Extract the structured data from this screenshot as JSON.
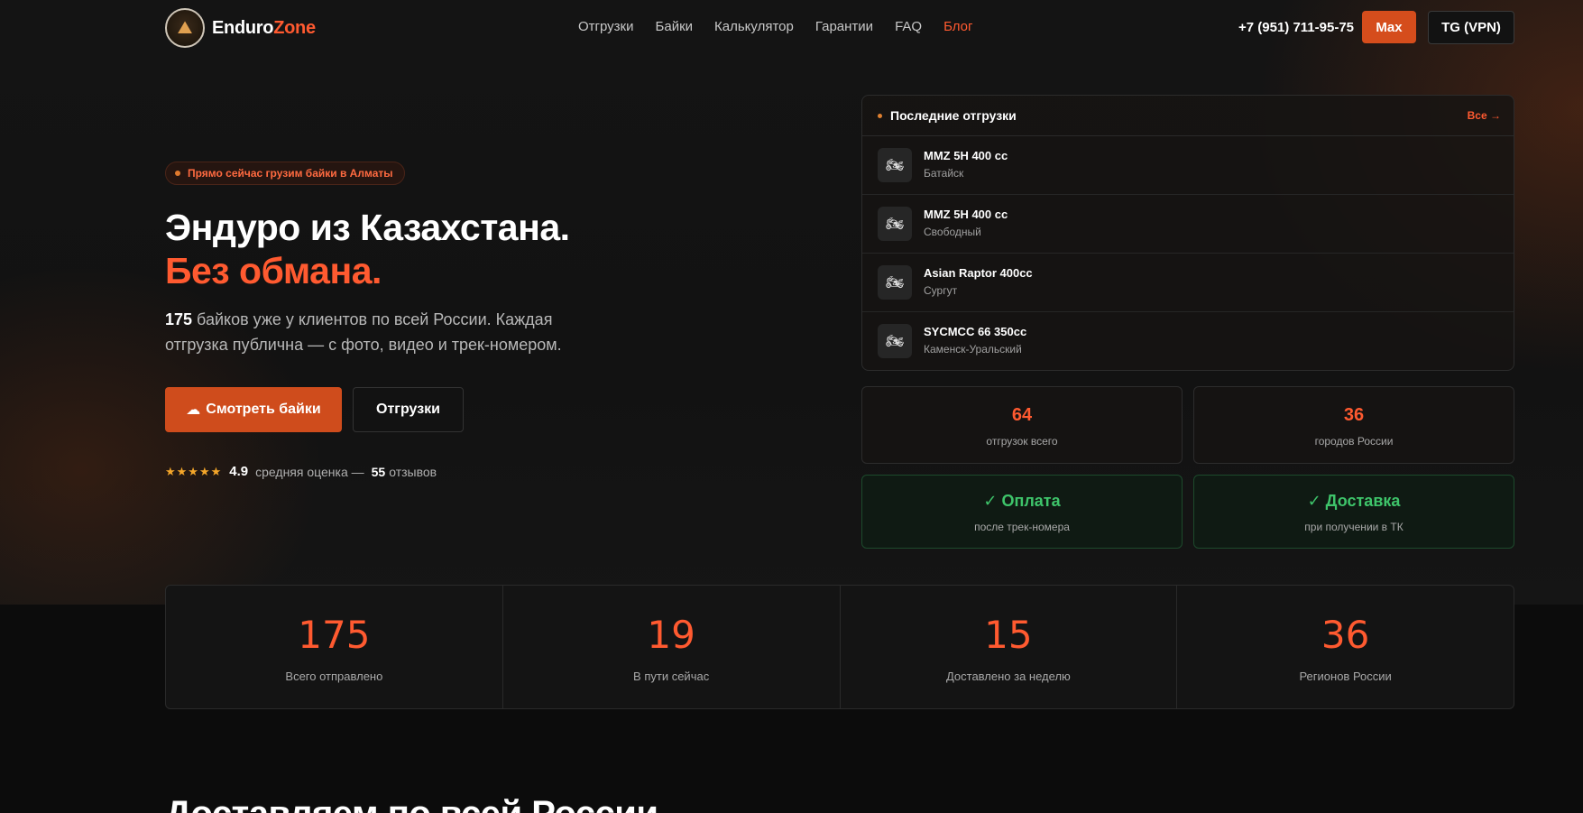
{
  "header": {
    "logo_a": "Enduro",
    "logo_b": "Zone",
    "nav": [
      {
        "label": "Отгрузки"
      },
      {
        "label": "Байки"
      },
      {
        "label": "Калькулятор"
      },
      {
        "label": "Гарантии"
      },
      {
        "label": "FAQ"
      },
      {
        "label": "Блог"
      }
    ],
    "active_nav": "Блог",
    "phone": "+7 (951) 711-95-75",
    "max_label": "Max",
    "tg_label": "TG (VPN)"
  },
  "hero": {
    "badge": "Прямо сейчас грузим байки в Алматы",
    "title_line1": "Эндуро из Казахстана.",
    "title_line2": "Без обмана.",
    "desc_count": "175",
    "desc_rest_line1": " байков уже у клиентов по всей России. Каждая",
    "desc_line2": "отгрузка публична — с фото, видео и трек-номером.",
    "primary_button": "Смотреть байки",
    "secondary_button": "Отгрузки",
    "stars": "★★★★★",
    "score": "4.9",
    "rating_mid": "средняя оценка —",
    "reviews_count": "55",
    "reviews_word": "отзывов"
  },
  "shipments": {
    "title": "Последние отгрузки",
    "all_link": "Все →",
    "items": [
      {
        "name": "MMZ 5H 400 cc",
        "city": "Батайск"
      },
      {
        "name": "MMZ 5H 400 cc",
        "city": "Свободный"
      },
      {
        "name": "Asian Raptor 400cc",
        "city": "Сургут"
      },
      {
        "name": "SYCMCC 66 350cc",
        "city": "Каменск-Уральский"
      }
    ]
  },
  "cards": {
    "shipments_total": {
      "value": "64",
      "label": "отгрузок всего"
    },
    "cities": {
      "value": "36",
      "label": "городов России"
    },
    "payment": {
      "value": "✓ Оплата",
      "label": "после трек-номера"
    },
    "delivery": {
      "value": "✓ Доставка",
      "label": "при получении в ТК"
    }
  },
  "stats": [
    {
      "value": "175",
      "label": "Всего отправлено"
    },
    {
      "value": "19",
      "label": "В пути сейчас"
    },
    {
      "value": "15",
      "label": "Доставлено за неделю"
    },
    {
      "value": "36",
      "label": "Регионов России"
    }
  ],
  "next_section_title": "Доставляем по всей России",
  "colors": {
    "accent": "#ff5a30",
    "button": "#cf4c1c",
    "success": "#3ec46a",
    "star": "#f4a62a"
  }
}
